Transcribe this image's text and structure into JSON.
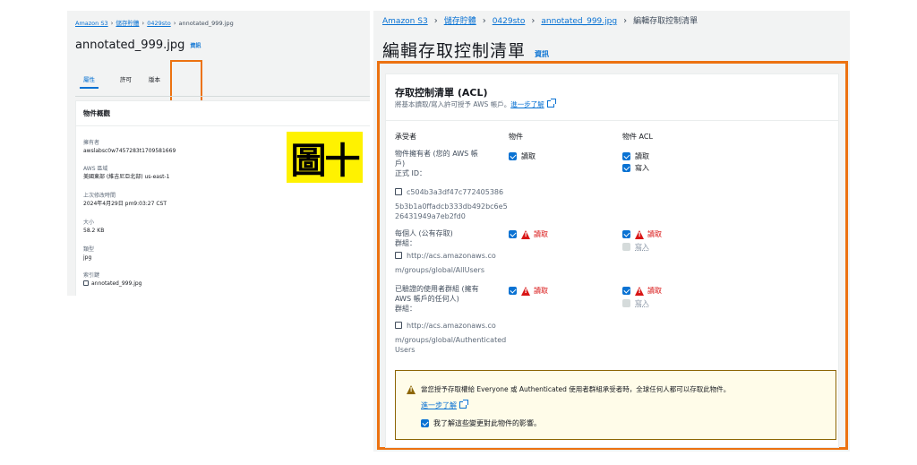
{
  "left": {
    "breadcrumbs": [
      "Amazon S3",
      "儲存貯體",
      "0429sto",
      "annotated_999.jpg"
    ],
    "title": "annotated_999.jpg",
    "info": "資訊",
    "tabs": [
      "屬性",
      "許可",
      "版本"
    ],
    "card_title": "物件概觀",
    "props": [
      {
        "label": "擁有者",
        "value": "awslabsc0w7457283t1709581669"
      },
      {
        "label": "AWS 區域",
        "value": "美國東部 (維吉尼亞北部) us-east-1"
      },
      {
        "label": "上次修改時間",
        "value": "2024年4月29日 pm9:03:27 CST"
      },
      {
        "label": "大小",
        "value": "58.2 KB"
      },
      {
        "label": "類型",
        "value": "jpg"
      },
      {
        "label": "索引鍵",
        "value": "annotated_999.jpg"
      }
    ]
  },
  "figure_label": "圖十",
  "right": {
    "breadcrumbs": [
      "Amazon S3",
      "儲存貯體",
      "0429sto",
      "annotated_999.jpg",
      "編輯存取控制清單"
    ],
    "page_title": "編輯存取控制清單",
    "info": "資訊",
    "card_title": "存取控制清單 (ACL)",
    "card_desc": "將基本讀取/寫入許可授予 AWS 帳戶。",
    "learn_more": "進一步了解",
    "columns": [
      "承受者",
      "物件",
      "物件 ACL"
    ],
    "grantees": [
      {
        "name_lines": [
          "物件擁有者 (您的 AWS 帳",
          "戶)"
        ],
        "id_label": "正式 ID：",
        "id_lines": [
          "c504b3a3df47c772405386",
          "5b3b1a0ffadcb333db492bc6e5",
          "26431949a7eb2fd0"
        ],
        "object_read": "讀取",
        "acl_read": "讀取",
        "acl_write": "寫入"
      },
      {
        "name_lines": [
          "每個人 (公有存取)"
        ],
        "id_label": "群組：",
        "id_lines": [
          "http://acs.amazonaws.co",
          "m/groups/global/AllUsers"
        ],
        "object_read": "讀取",
        "acl_read": "讀取",
        "acl_write": "寫入"
      },
      {
        "name_lines": [
          "已驗證的使用者群組 (擁有",
          "AWS 帳戶的任何人)"
        ],
        "id_label": "群組：",
        "id_lines": [
          "http://acs.amazonaws.co",
          "m/groups/global/Authenticated",
          "Users"
        ],
        "object_read": "讀取",
        "acl_read": "讀取",
        "acl_write": "寫入"
      }
    ],
    "alert": {
      "message": "當您授予存取權給 Everyone 或 Authenticated 使用者群組承受者時，全球任何人都可以存取此物件。",
      "learn_more": "進一步了解",
      "ack": "我了解這些變更對此物件的影響。"
    }
  },
  "colors": {
    "accent": "#0972d3",
    "highlight": "#ec7211",
    "warning": "#d91515",
    "label_bg": "#fff200"
  }
}
